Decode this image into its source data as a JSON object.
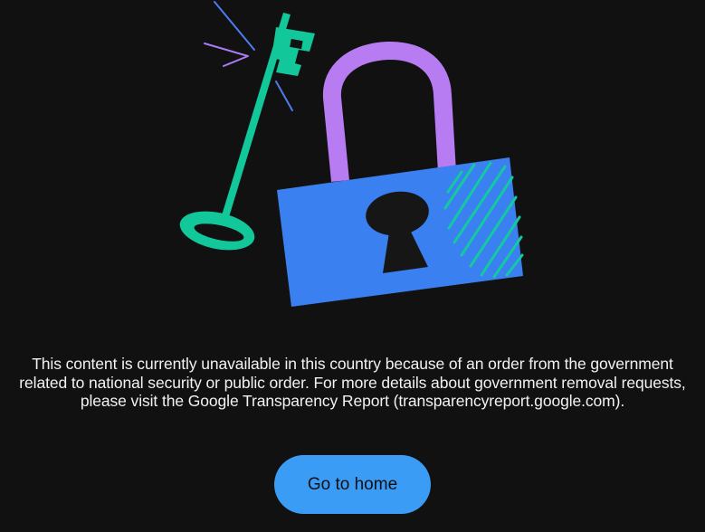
{
  "message": {
    "line1": "This content is currently unavailable in this country because of an order from the government",
    "line2": "related to national security or public order. For more details about government removal requests,",
    "line3": "please visit the Google Transparency Report (transparencyreport.google.com)."
  },
  "actions": {
    "home_label": "Go to home"
  },
  "illustration": {
    "key_icon": "key-icon",
    "lock_icon": "padlock-icon",
    "colors": {
      "background": "#111111",
      "key": "#12c79a",
      "shackle": "#b77bf2",
      "lock_body": "#3a80f0",
      "keyhole": "#161616",
      "sparkle_blue": "#4d7cf0",
      "sparkle_purple": "#a97cf5",
      "button": "#3b9cf6"
    }
  }
}
